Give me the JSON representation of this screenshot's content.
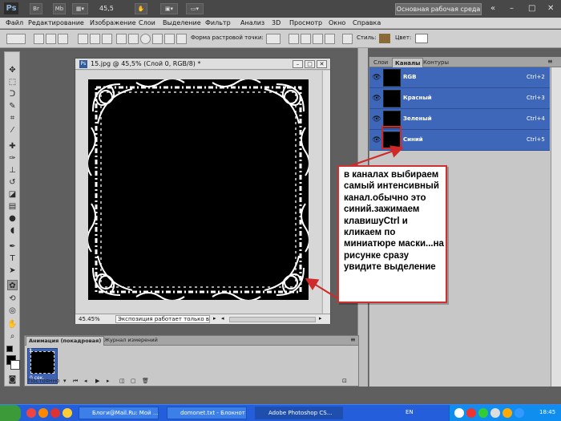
{
  "app": {
    "logo": "Ps",
    "zoom_display": "45,5",
    "workspace_label": "Основная рабочая среда",
    "window_controls": [
      "«",
      "–",
      "□",
      "✕"
    ]
  },
  "menu": [
    "Файл",
    "Редактирование",
    "Изображение",
    "Слои",
    "Выделение",
    "Фильтр",
    "Анализ",
    "3D",
    "Просмотр",
    "Окно",
    "Справка"
  ],
  "options_bar": {
    "brush_label": "Форма растровой точки:",
    "style_label": "Стиль:",
    "color_label": "Цвет:",
    "style_color": "#8b6a3a",
    "color_value": "#ffffff"
  },
  "document": {
    "title": "15.jpg @ 45,5% (Слой 0, RGB/8) *",
    "zoom": "45.45%",
    "status_text": "Экспозиция работает только в ..."
  },
  "channels_panel": {
    "tabs": [
      "Слои",
      "Каналы",
      "Контуры"
    ],
    "active_tab": "Каналы",
    "rows": [
      {
        "name": "RGB",
        "shortcut": "Ctrl+2"
      },
      {
        "name": "Красный",
        "shortcut": "Ctrl+3"
      },
      {
        "name": "Зеленый",
        "shortcut": "Ctrl+4"
      },
      {
        "name": "Синий",
        "shortcut": "Ctrl+5"
      }
    ],
    "highlight_color": "#3e66b9"
  },
  "annotation": {
    "text": "в каналах выбираем самый интенсивный канал.обычно это синий.зажимаем клавишуCtrl и кликаем по миниатюре маски...на рисунке сразу увидите выделение",
    "border_color": "#cf3030"
  },
  "animation_panel": {
    "tabs": [
      "Анимация (покадровая)",
      "Журнал измерений"
    ],
    "frame_number": "1",
    "frame_delay": "0 сек.",
    "loop_label": "Постоянно"
  },
  "taskbar": {
    "buttons": [
      "Блоги@Mail.Ru: Мой ...",
      "domonet.txt - Блокнот",
      "Adobe Photoshop CS..."
    ],
    "active_button": 2,
    "language": "EN",
    "clock": "18:45"
  }
}
